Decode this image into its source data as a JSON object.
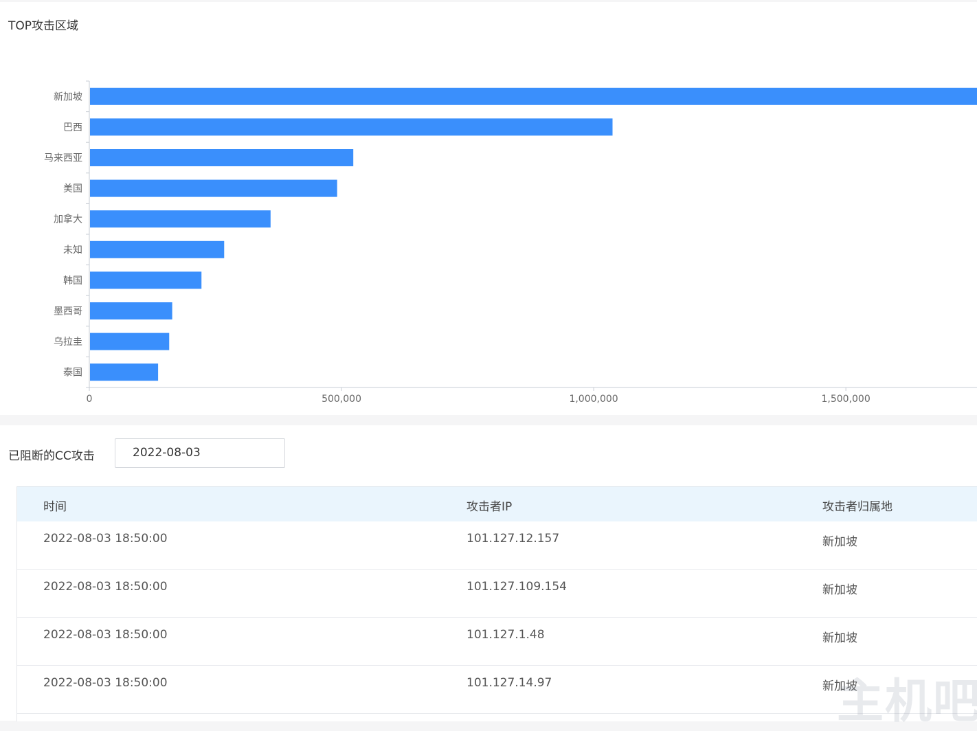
{
  "top_regions": {
    "title": "TOP攻击区域"
  },
  "chart_data": {
    "type": "bar",
    "orientation": "horizontal",
    "title": "TOP攻击区域",
    "categories": [
      "新加坡",
      "巴西",
      "马来西亚",
      "美国",
      "加拿大",
      "未知",
      "韩国",
      "墨西哥",
      "乌拉圭",
      "泰国"
    ],
    "values": [
      1760000,
      1036000,
      522000,
      490000,
      358000,
      266000,
      221000,
      163000,
      157000,
      135000
    ],
    "x_ticks": [
      0,
      500000,
      1000000,
      1500000
    ],
    "x_tick_labels": [
      "0",
      "500,000",
      "1,000,000",
      "1,500,000"
    ],
    "xlim": [
      0,
      1760000
    ],
    "bar_color": "#3a8ffc",
    "grid": false,
    "legend": "none"
  },
  "blocked": {
    "label": "已阻断的CC攻击",
    "date_value": "2022-08-03",
    "columns": [
      "时间",
      "攻击者IP",
      "攻击者归属地"
    ],
    "rows": [
      [
        "2022-08-03 18:50:00",
        "101.127.12.157",
        "新加坡"
      ],
      [
        "2022-08-03 18:50:00",
        "101.127.109.154",
        "新加坡"
      ],
      [
        "2022-08-03 18:50:00",
        "101.127.1.48",
        "新加坡"
      ],
      [
        "2022-08-03 18:50:00",
        "101.127.14.97",
        "新加坡"
      ]
    ]
  },
  "watermark": "主机吧",
  "colors": {
    "accent": "#3a8ffc",
    "header_bg": "#eaf5fd"
  }
}
